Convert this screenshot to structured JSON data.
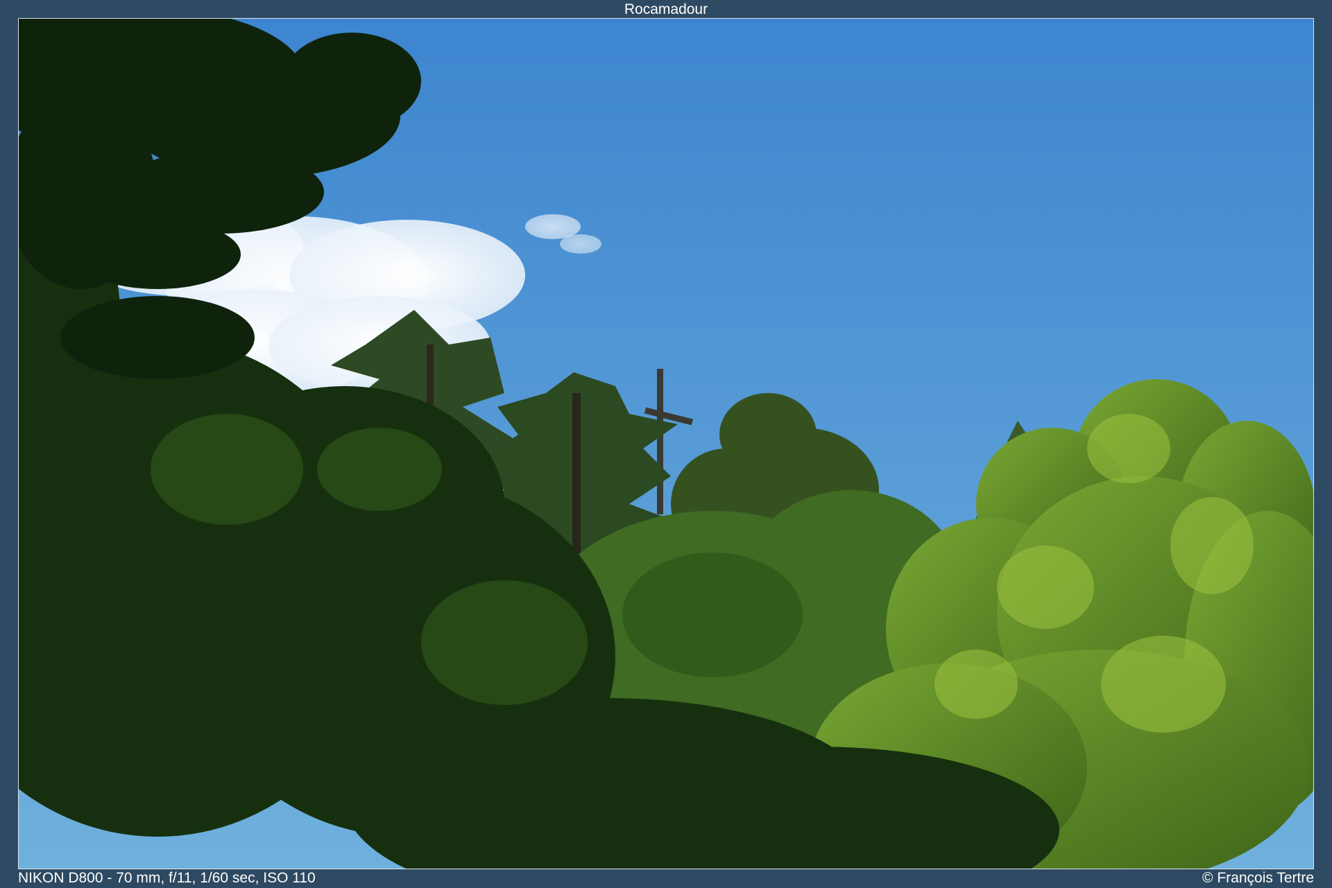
{
  "title": "Rocamadour",
  "caption": {
    "camera": "NIKON D800 - 70 mm, f/11, 1/60 sec, ISO 110",
    "copyright": "© François Tertre"
  },
  "colors": {
    "background": "#2e4a62",
    "sky_top": "#3f86cf",
    "sky_bottom": "#6aaad8",
    "foliage_dark": "#142a10",
    "foliage_mid": "#3d6a1f",
    "foliage_light": "#8fb63a"
  }
}
